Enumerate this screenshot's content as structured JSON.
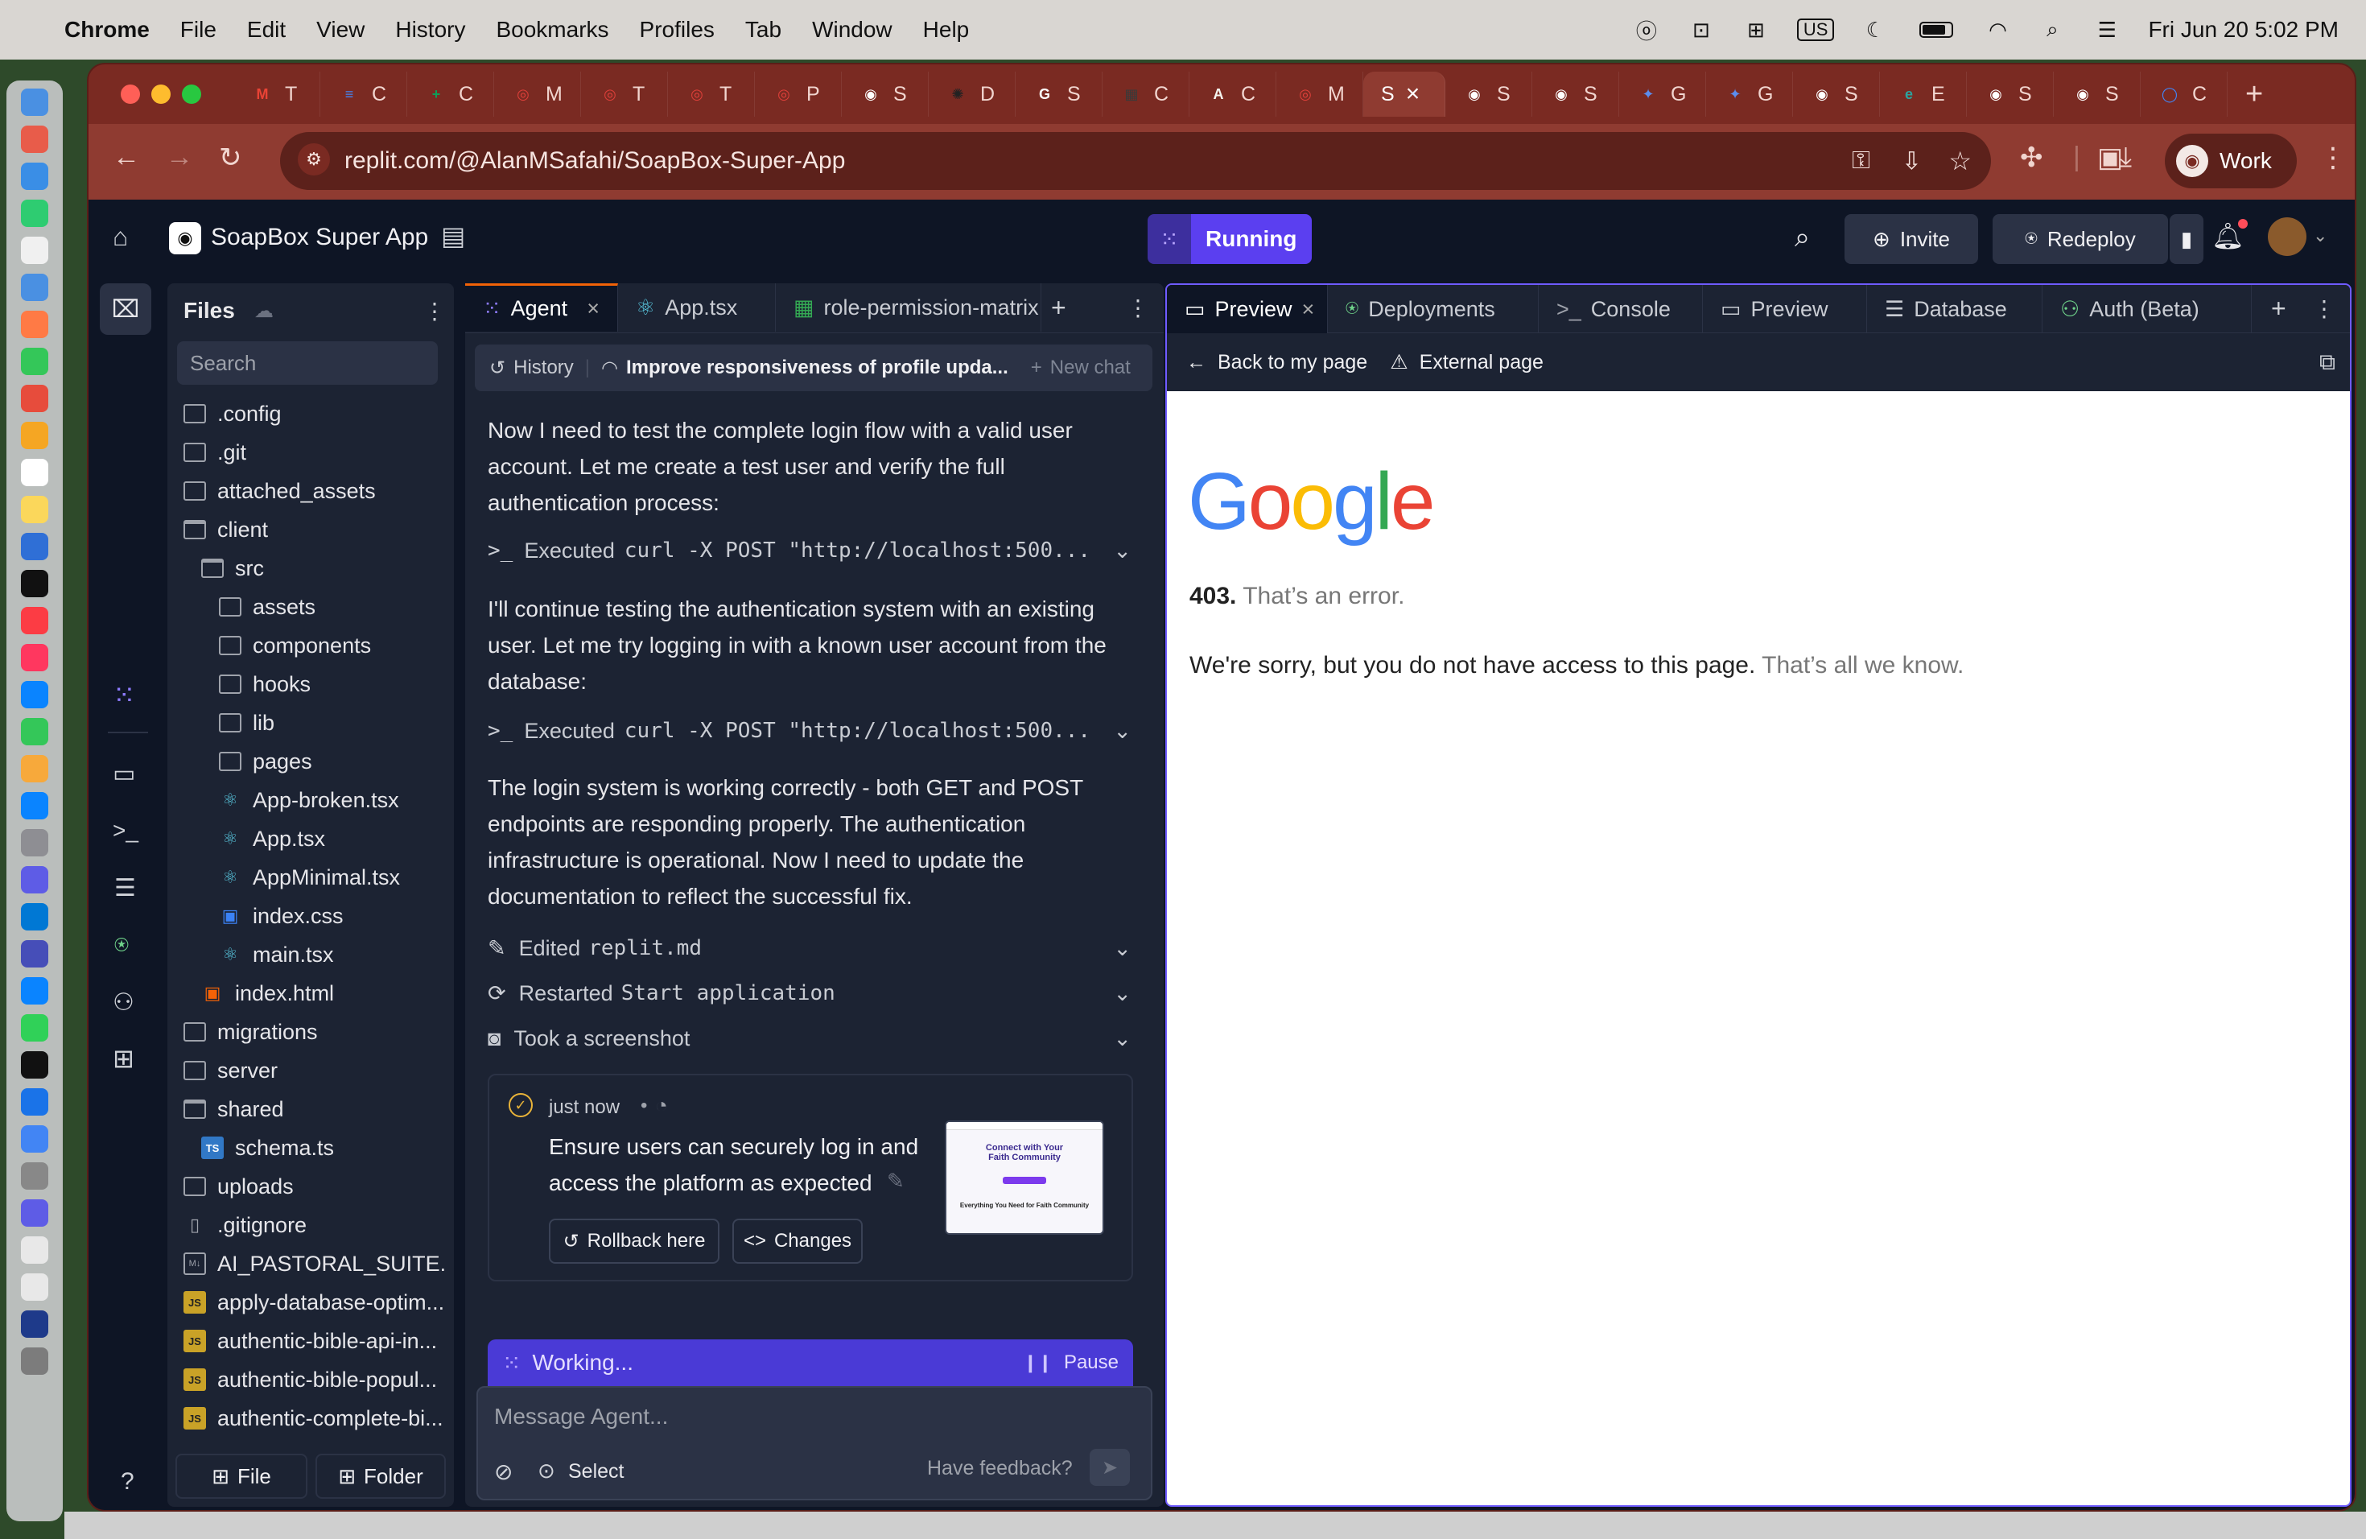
{
  "menubar": {
    "app_name": "Chrome",
    "items": [
      "File",
      "Edit",
      "View",
      "History",
      "Bookmarks",
      "Profiles",
      "Tab",
      "Window",
      "Help"
    ],
    "keyboard": "US",
    "clock": "Fri Jun 20  5:02 PM"
  },
  "browser": {
    "tabs": [
      {
        "letter": "T",
        "icon": "gmail-icon",
        "color": "#ea4335",
        "glyph": "M"
      },
      {
        "letter": "C",
        "icon": "docs-icon",
        "color": "#4285f4",
        "glyph": "≡"
      },
      {
        "letter": "C",
        "icon": "sheets-icon",
        "color": "#0f9d58",
        "glyph": "+"
      },
      {
        "letter": "M",
        "icon": "target-icon",
        "color": "#e0403a",
        "glyph": "◎"
      },
      {
        "letter": "T",
        "icon": "target-icon",
        "color": "#e0403a",
        "glyph": "◎"
      },
      {
        "letter": "T",
        "icon": "target-icon",
        "color": "#e0403a",
        "glyph": "◎"
      },
      {
        "letter": "P",
        "icon": "target-icon",
        "color": "#e0403a",
        "glyph": "◎"
      },
      {
        "letter": "S",
        "icon": "soapbox-icon",
        "color": "#ffffff",
        "glyph": "◉"
      },
      {
        "letter": "D",
        "icon": "openai-icon",
        "color": "#222222",
        "glyph": "✺"
      },
      {
        "letter": "S",
        "icon": "google-icon",
        "color": "#ffffff",
        "glyph": "G"
      },
      {
        "letter": "C",
        "icon": "calendar-icon",
        "color": "#3a3a3a",
        "glyph": "▦"
      },
      {
        "letter": "C",
        "icon": "anthropic-icon",
        "color": "#f5f5f0",
        "glyph": "A"
      },
      {
        "letter": "M",
        "icon": "target-icon",
        "color": "#e0403a",
        "glyph": "◎"
      },
      {
        "letter": "S",
        "icon": "soapbox-icon",
        "color": "#ffffff",
        "glyph": "◉"
      },
      {
        "letter": "S",
        "icon": "soapbox-icon",
        "color": "#ffffff",
        "glyph": "◉"
      },
      {
        "letter": "G",
        "icon": "gemini-icon",
        "color": "#5b8dee",
        "glyph": "✦"
      },
      {
        "letter": "G",
        "icon": "gemini-icon",
        "color": "#5b8dee",
        "glyph": "✦"
      },
      {
        "letter": "S",
        "icon": "soapbox-icon",
        "color": "#ffffff",
        "glyph": "◉"
      },
      {
        "letter": "E",
        "icon": "edge-icon",
        "color": "#2aa5a0",
        "glyph": "e"
      },
      {
        "letter": "S",
        "icon": "soapbox-icon",
        "color": "#ffffff",
        "glyph": "◉"
      },
      {
        "letter": "S",
        "icon": "soapbox-icon",
        "color": "#ffffff",
        "glyph": "◉"
      },
      {
        "letter": "C",
        "icon": "chrome-icon",
        "color": "#4285f4",
        "glyph": "◯"
      }
    ],
    "active_tab_letter": "S",
    "url": "replit.com/@AlanMSafahi/SoapBox-Super-App",
    "profile": "Work"
  },
  "replit": {
    "app_title": "SoapBox Super App",
    "status": "Running",
    "invite": "Invite",
    "redeploy": "Redeploy",
    "files": {
      "title": "Files",
      "search_placeholder": "Search",
      "items": [
        {
          "name": ".config",
          "type": "folder",
          "indent": 0
        },
        {
          "name": ".git",
          "type": "folder",
          "indent": 0
        },
        {
          "name": "attached_assets",
          "type": "folder",
          "indent": 0
        },
        {
          "name": "client",
          "type": "folder-open",
          "indent": 0
        },
        {
          "name": "src",
          "type": "folder-open",
          "indent": 1
        },
        {
          "name": "assets",
          "type": "folder",
          "indent": 2
        },
        {
          "name": "components",
          "type": "folder",
          "indent": 2
        },
        {
          "name": "hooks",
          "type": "folder",
          "indent": 2
        },
        {
          "name": "lib",
          "type": "folder",
          "indent": 2
        },
        {
          "name": "pages",
          "type": "folder",
          "indent": 2
        },
        {
          "name": "App-broken.tsx",
          "type": "react",
          "indent": 2
        },
        {
          "name": "App.tsx",
          "type": "react",
          "indent": 2
        },
        {
          "name": "AppMinimal.tsx",
          "type": "react",
          "indent": 2
        },
        {
          "name": "index.css",
          "type": "css",
          "indent": 2
        },
        {
          "name": "main.tsx",
          "type": "react",
          "indent": 2
        },
        {
          "name": "index.html",
          "type": "html",
          "indent": 1
        },
        {
          "name": "migrations",
          "type": "folder",
          "indent": 0
        },
        {
          "name": "server",
          "type": "folder",
          "indent": 0
        },
        {
          "name": "shared",
          "type": "folder-open",
          "indent": 0
        },
        {
          "name": "schema.ts",
          "type": "ts",
          "indent": 1
        },
        {
          "name": "uploads",
          "type": "folder",
          "indent": 0
        },
        {
          "name": ".gitignore",
          "type": "file",
          "indent": 0
        },
        {
          "name": "AI_PASTORAL_SUITE...",
          "type": "md",
          "indent": 0
        },
        {
          "name": "apply-database-optim...",
          "type": "js",
          "indent": 0
        },
        {
          "name": "authentic-bible-api-in...",
          "type": "js",
          "indent": 0
        },
        {
          "name": "authentic-bible-popul...",
          "type": "js",
          "indent": 0
        },
        {
          "name": "authentic-complete-bi...",
          "type": "js",
          "indent": 0
        }
      ],
      "new_file": "File",
      "new_folder": "Folder"
    },
    "editor_tabs": [
      "Agent",
      "App.tsx",
      "role-permission-matrix"
    ],
    "agent": {
      "history": "History",
      "chat_title": "Improve responsiveness of profile upda...",
      "new_chat": "New chat",
      "msg1": "Now I need to test the complete login flow with a valid user account. Let me create a test user and verify the full authentication process:",
      "exec1_prefix": ">_",
      "exec1_label": "Executed",
      "exec1_cmd": "curl -X POST \"http://localhost:500...",
      "msg2": "I'll continue testing the authentication system with an existing user. Let me try logging in with a known user account from the database:",
      "exec2_prefix": ">_",
      "exec2_label": "Executed",
      "exec2_cmd": "curl -X POST \"http://localhost:500...",
      "msg3": "The login system is working correctly - both GET and POST endpoints are responding properly. The authentication infrastructure is operational. Now I need to update the documentation to reflect the successful fix.",
      "step_edited": "Edited",
      "step_edited_file": "replit.md",
      "step_restarted": "Restarted",
      "step_restarted_target": "Start application",
      "step_screenshot": "Took a screenshot",
      "checkpoint_time": "just now",
      "checkpoint_text": "Ensure users can securely log in and access the platform as expected",
      "thumb_title": "Connect with Your Faith Community",
      "thumb_sub": "Everything You Need for Faith Community",
      "rollback": "Rollback here",
      "changes": "Changes",
      "working": "Working...",
      "pause": "Pause",
      "input_placeholder": "Message Agent...",
      "select": "Select",
      "feedback": "Have feedback?"
    },
    "preview_tabs": [
      "Preview",
      "Deployments",
      "Console",
      "Preview",
      "Database",
      "Auth (Beta)"
    ],
    "preview": {
      "back": "Back to my page",
      "external": "External page",
      "google_letters": [
        {
          "ch": "G",
          "color": "#4285f4"
        },
        {
          "ch": "o",
          "color": "#ea4335"
        },
        {
          "ch": "o",
          "color": "#fbbc05"
        },
        {
          "ch": "g",
          "color": "#4285f4"
        },
        {
          "ch": "l",
          "color": "#34a853"
        },
        {
          "ch": "e",
          "color": "#ea4335"
        }
      ],
      "error_code": "403.",
      "error_title": "That’s an error.",
      "error_msg": "We're sorry, but you do not have access to this page.",
      "error_tail": "That’s all we know."
    }
  }
}
